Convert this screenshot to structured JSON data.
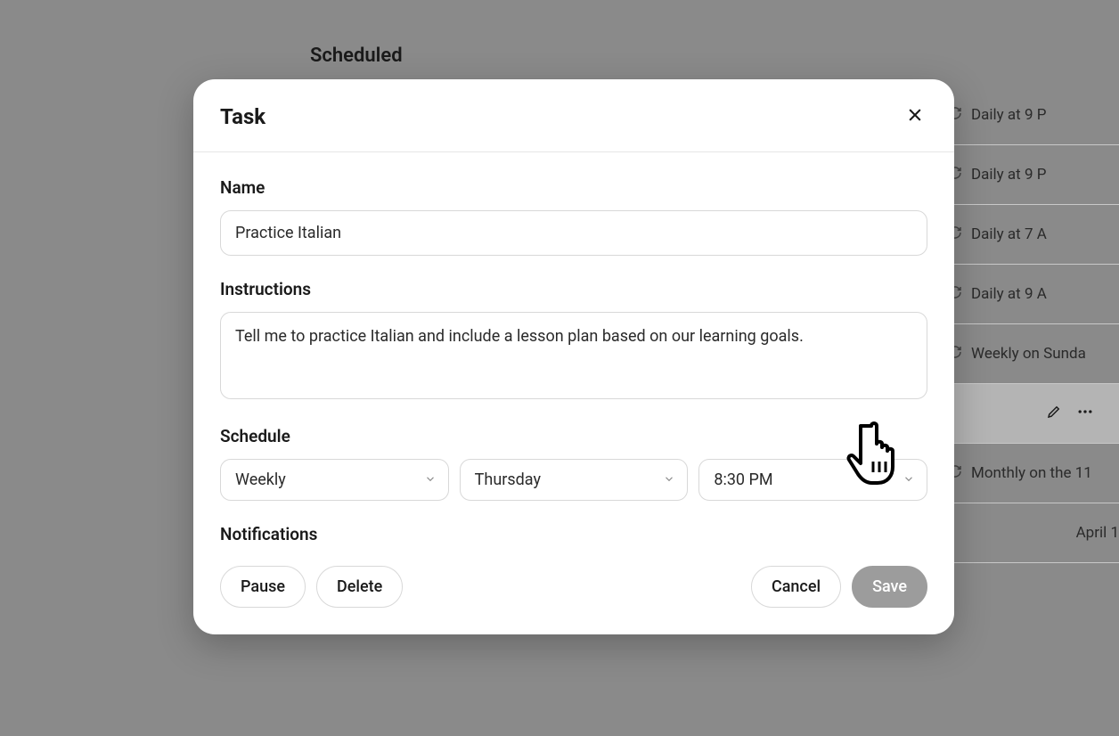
{
  "page": {
    "heading": "Scheduled"
  },
  "modal": {
    "title": "Task",
    "fields": {
      "name_label": "Name",
      "name_value": "Practice Italian",
      "instructions_label": "Instructions",
      "instructions_value": "Tell me to practice Italian and include a lesson plan based on our learning goals.",
      "schedule_label": "Schedule",
      "notifications_label": "Notifications"
    },
    "schedule": {
      "frequency": "Weekly",
      "day": "Thursday",
      "time": "8:30 PM"
    },
    "buttons": {
      "pause": "Pause",
      "delete": "Delete",
      "cancel": "Cancel",
      "save": "Save"
    }
  },
  "background_tasks": [
    {
      "label": "Daily at 9 P"
    },
    {
      "label": "Daily at 9 P"
    },
    {
      "label": "Daily at 7 A"
    },
    {
      "label": "Daily at 9 A"
    },
    {
      "label": "Weekly on Sunda"
    },
    {
      "label": "",
      "icons_row": true
    },
    {
      "label": "Monthly on the 11"
    },
    {
      "label": "April 1",
      "no_icon": true
    }
  ]
}
